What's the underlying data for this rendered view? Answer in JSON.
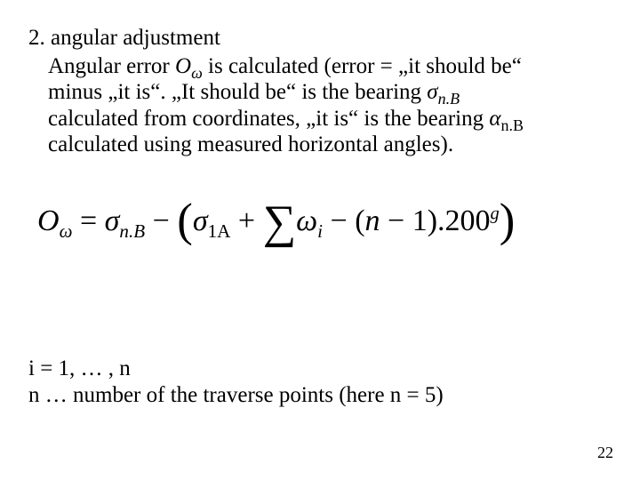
{
  "heading": "2. angular adjustment",
  "line1_a": "Angular error ",
  "line1_ovar": "O",
  "line1_osub": "ω",
  "line1_b": " is calculated (error = „it should be“",
  "line2_a": "minus „it is“. „It should be“ is the bearing ",
  "line2_sigma": "σ",
  "line2_sub": "n.B",
  "line3_a": "calculated from coordinates, „it is“ is the bearing ",
  "line3_alpha": "α",
  "line3_sub": "n.B",
  "line4": "calculated using measured horizontal angles).",
  "f": {
    "O": "O",
    "Osub": "ω",
    "eq": " = ",
    "sig": "σ",
    "nB": "n.B",
    "minus": " − ",
    "lpar": "(",
    "sig2": "σ",
    "oneA": "1A",
    "plus": " + ",
    "sum": "∑",
    "omega": "ω",
    "i": "i",
    "minus2": " −  ",
    "lpar2": "(",
    "n": "n",
    "minus3": "  −  ",
    "one": "1",
    "rpar2": ")",
    "dot": ".",
    "twohund": "200",
    "g": "g",
    "rpar": ")"
  },
  "lower1": "i = 1, … , n",
  "lower2": "n … number of the traverse points (here n = 5)",
  "page": "22"
}
